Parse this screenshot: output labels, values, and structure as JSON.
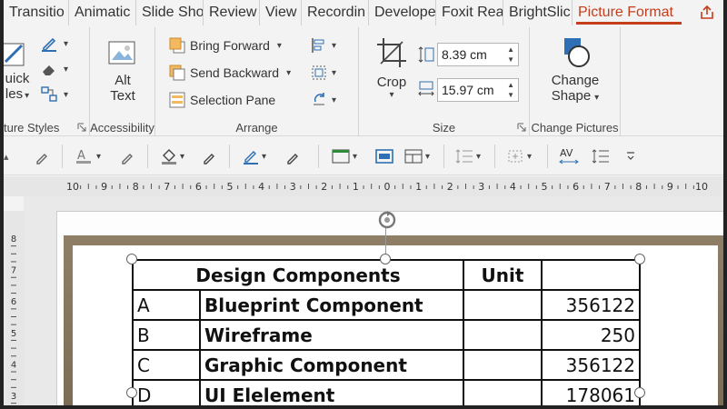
{
  "tabs": [
    "Transitio",
    "Animatic",
    "Slide Sho",
    "Review",
    "View",
    "Recordin",
    "Develope",
    "Foxit Rea",
    "BrightSlic",
    "Picture Format"
  ],
  "active_tab": "Picture Format",
  "ribbon": {
    "picture_styles": {
      "quick_styles_line1": "uick",
      "quick_styles_line2": "les",
      "label": "ture Styles"
    },
    "accessibility": {
      "alt_text_line1": "Alt",
      "alt_text_line2": "Text",
      "label": "Accessibility"
    },
    "arrange": {
      "bring_forward": "Bring Forward",
      "send_backward": "Send Backward",
      "selection_pane": "Selection Pane",
      "label": "Arrange"
    },
    "size": {
      "crop": "Crop",
      "height": "8.39 cm",
      "width": "15.97 cm",
      "label": "Size"
    },
    "change_pictures": {
      "change_shape_line1": "Change",
      "change_shape_line2": "Shape",
      "label": "Change Pictures"
    }
  },
  "ruler": {
    "ticks": [
      "10",
      "9",
      "8",
      "7",
      "6",
      "5",
      "4",
      "3",
      "2",
      "1",
      "0",
      "1",
      "2",
      "3",
      "4",
      "5",
      "6",
      "7",
      "8",
      "9",
      "10"
    ]
  },
  "vruler": {
    "ticks": [
      "8",
      "7",
      "6",
      "5",
      "4",
      "3"
    ]
  },
  "table": {
    "header": {
      "col2": "Design Components",
      "col3": "Unit"
    },
    "rows": [
      {
        "id": "A",
        "name": "Blueprint Component",
        "unit": "",
        "value": "356122"
      },
      {
        "id": "B",
        "name": "Wireframe",
        "unit": "",
        "value": "250"
      },
      {
        "id": "C",
        "name": "Graphic Component",
        "unit": "",
        "value": "356122"
      },
      {
        "id": "D",
        "name": "UI Elelement",
        "unit": "",
        "value": "178061"
      }
    ]
  },
  "colors": {
    "accent": "#c43e1c",
    "picture_border": "#8a7a62"
  }
}
